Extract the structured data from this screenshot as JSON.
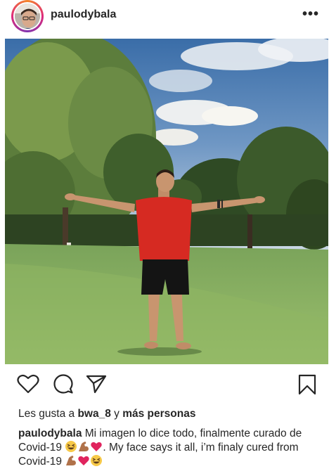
{
  "post": {
    "username": "paulodybala",
    "more_label": "•••"
  },
  "likes": {
    "prefix": "Les gusta a ",
    "user": "bwa_8",
    "middle": " y ",
    "others": "más personas"
  },
  "caption": {
    "username": "paulodybala",
    "text_part1": " Mi imagen lo dice todo, finalmente curado de Covid-19 ",
    "text_part2": ". My face says it all, i’m finaly cured from Covid-19 ",
    "emojis_1": [
      "grinning-squinting-face",
      "flexed-biceps",
      "red-heart"
    ],
    "emojis_2": [
      "flexed-biceps",
      "red-heart",
      "grinning-squinting-face"
    ]
  },
  "colors": {
    "text": "#262626",
    "ring_orange": "#f58529",
    "ring_pink": "#dd2a7b",
    "ring_purple": "#8134af",
    "heart_red": "#e0245e"
  }
}
